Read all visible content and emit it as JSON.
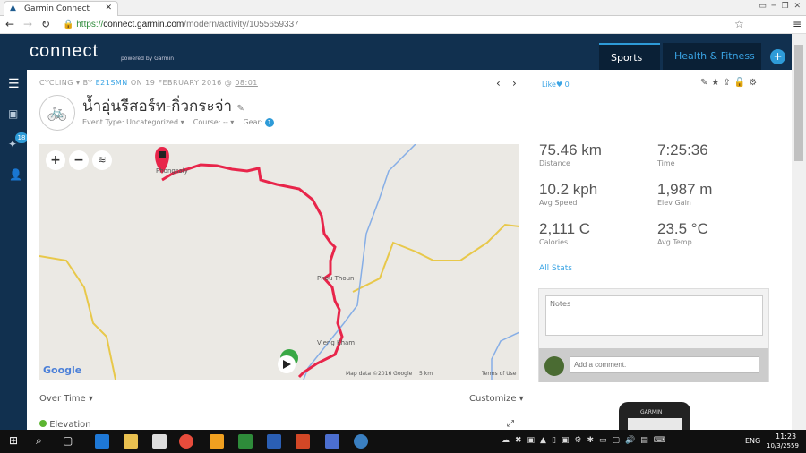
{
  "browser": {
    "tab_title": "Garmin Connect",
    "url_scheme": "https://",
    "url_host": "connect.garmin.com",
    "url_path": "/modern/activity/1055659337"
  },
  "header": {
    "logo": "connect",
    "powered": "powered by Garmin",
    "nav": [
      {
        "label": "Sports"
      },
      {
        "label": "Health & Fitness"
      }
    ],
    "add": "+"
  },
  "sidebar": {
    "badge": "18"
  },
  "activity": {
    "type": "CYCLING",
    "by": "BY",
    "user": "E21SMN",
    "on": "ON 19 FEBRUARY 2016 @",
    "time": "08:01",
    "title": "น้ำอุ่นรีสอร์ท-กิ่วกระจ่า",
    "event_type": "Event Type: Uncategorized",
    "course": "Course: --",
    "gear": "Gear:",
    "gear_count": "1",
    "like": "Like",
    "like_count": "0"
  },
  "map": {
    "labels": [
      "Phongsaly",
      "Phou Thoun",
      "Vieng Kham"
    ],
    "attribution": "Map data ©2016 Google",
    "scale": "5 km",
    "terms": "Terms of Use",
    "google": "Google",
    "route_color": "#e8254a"
  },
  "stats": [
    {
      "value": "75.46 km",
      "label": "Distance"
    },
    {
      "value": "7:25:36",
      "label": "Time"
    },
    {
      "value": "10.2 kph",
      "label": "Avg Speed"
    },
    {
      "value": "1,987 m",
      "label": "Elev Gain"
    },
    {
      "value": "2,111 C",
      "label": "Calories"
    },
    {
      "value": "23.5 °C",
      "label": "Avg Temp"
    }
  ],
  "all_stats": "All Stats",
  "notes": {
    "placeholder": "Notes",
    "comment_placeholder": "Add a comment."
  },
  "chart": {
    "over_time": "Over Time",
    "customize": "Customize",
    "elevation": "Elevation"
  },
  "device": {
    "brand": "GARMIN"
  },
  "taskbar": {
    "lang": "ENG",
    "time": "11:23",
    "date": "10/3/2559"
  }
}
